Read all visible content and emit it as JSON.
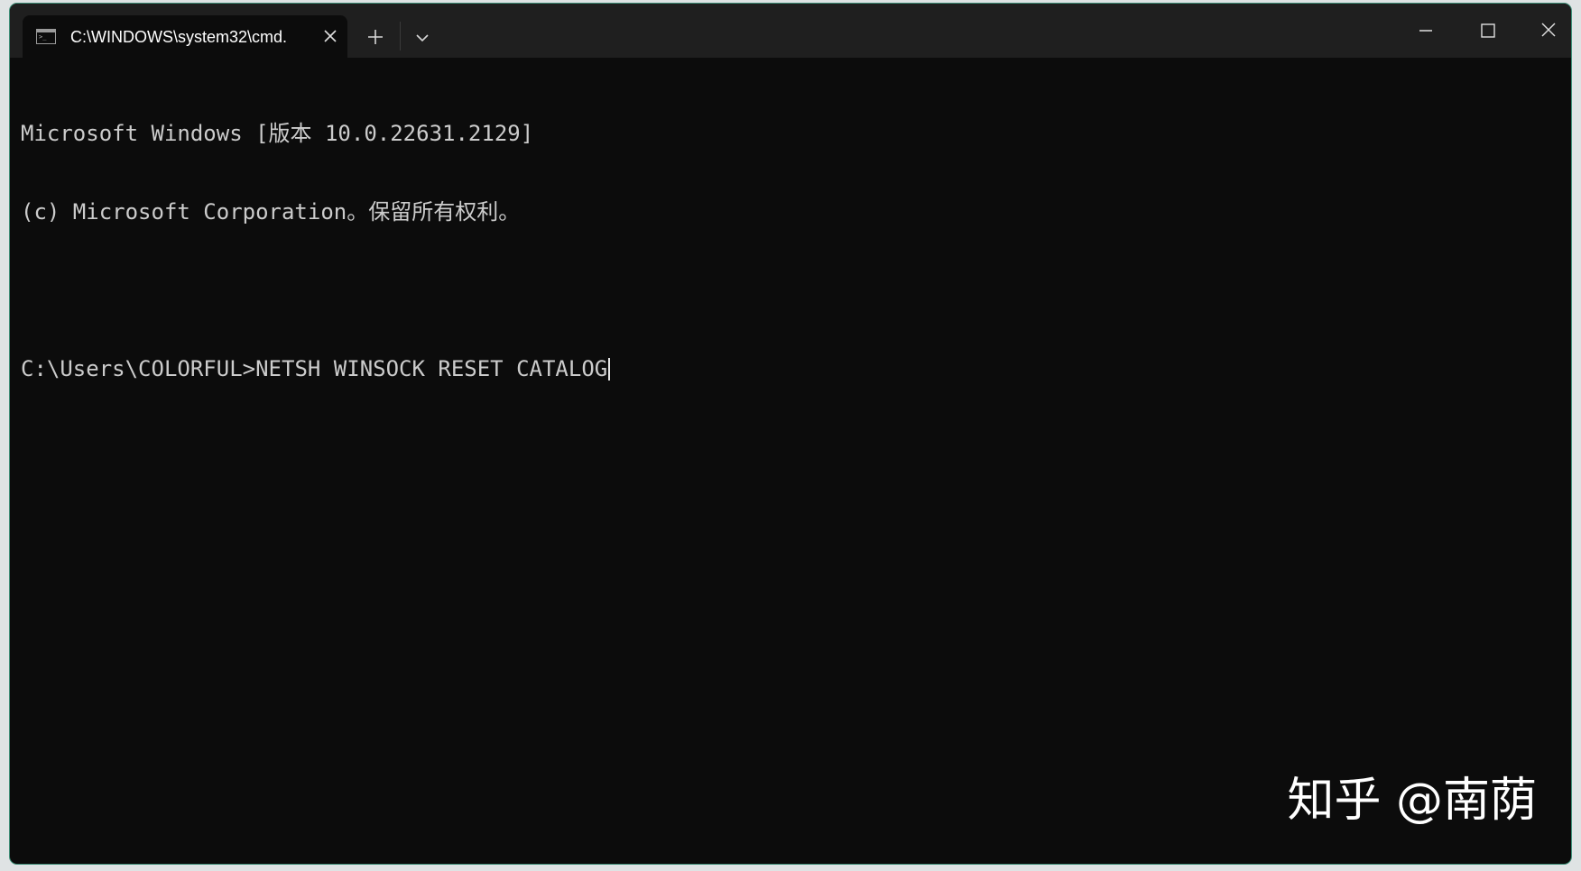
{
  "tab": {
    "icon": "cmd-icon",
    "prompt_glyph": ">_",
    "title": "C:\\WINDOWS\\system32\\cmd."
  },
  "console": {
    "lines": [
      "Microsoft Windows [版本 10.0.22631.2129]",
      "(c) Microsoft Corporation。保留所有权利。",
      "",
      "C:\\Users\\COLORFUL>"
    ],
    "typed_command": "NETSH WINSOCK RESET CATALOG"
  },
  "watermark": "知乎 @南荫",
  "colors": {
    "console_bg": "#0c0c0c",
    "console_text": "#cccccc",
    "titlebar_bg": "#1f1f1f",
    "window_border": "#3f8f78"
  }
}
